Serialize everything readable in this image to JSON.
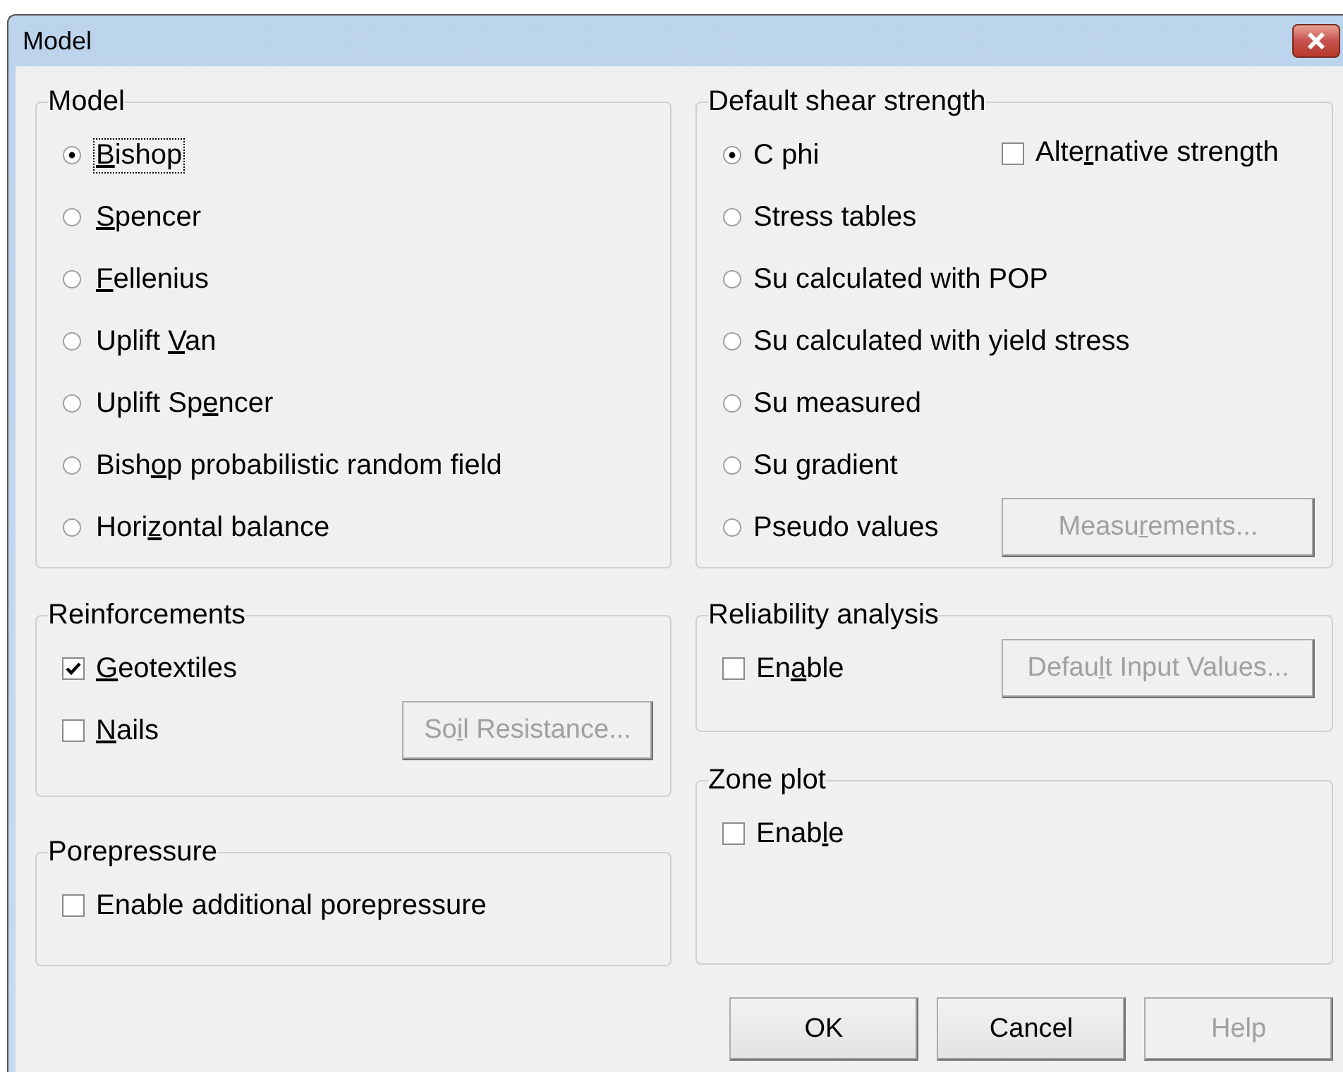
{
  "window": {
    "title": "Model"
  },
  "model": {
    "title": "Model",
    "options": [
      {
        "label": {
          "key": "B",
          "post": "ishop"
        },
        "selected": true,
        "focused": true
      },
      {
        "label": {
          "key": "S",
          "post": "pencer"
        },
        "selected": false,
        "focused": false
      },
      {
        "label": {
          "key": "F",
          "post": "ellenius"
        },
        "selected": false,
        "focused": false
      },
      {
        "label": {
          "pre": "Uplift ",
          "key": "V",
          "post": "an"
        },
        "selected": false,
        "focused": false
      },
      {
        "label": {
          "pre": "Uplift Sp",
          "key": "e",
          "post": "ncer"
        },
        "selected": false,
        "focused": false
      },
      {
        "label": {
          "pre": "Bish",
          "key": "o",
          "post": "p probabilistic random field"
        },
        "selected": false,
        "focused": false
      },
      {
        "label": {
          "pre": "Hori",
          "key": "z",
          "post": "ontal balance"
        },
        "selected": false,
        "focused": false
      }
    ]
  },
  "reinforcements": {
    "title": "Reinforcements",
    "checkboxes": [
      {
        "label": {
          "key": "G",
          "post": "eotextiles"
        },
        "checked": true
      },
      {
        "label": {
          "key": "N",
          "post": "ails"
        },
        "checked": false
      }
    ],
    "button": {
      "label": {
        "pre": "So",
        "key": "i",
        "post": "l Resistance..."
      },
      "disabled": true
    }
  },
  "porepressure": {
    "title": "Porepressure",
    "checkboxes": [
      {
        "label": {
          "pre": "Enable additional porepressure"
        },
        "checked": false
      }
    ]
  },
  "default_shear_strength": {
    "title": "Default shear strength",
    "options": [
      {
        "label": {
          "pre": "C phi"
        },
        "selected": true
      },
      {
        "label": {
          "pre": "Stress tables"
        },
        "selected": false
      },
      {
        "label": {
          "pre": "Su calculated with POP"
        },
        "selected": false
      },
      {
        "label": {
          "pre": "Su calculated with yield stress"
        },
        "selected": false
      },
      {
        "label": {
          "pre": "Su measured"
        },
        "selected": false
      },
      {
        "label": {
          "pre": "Su gradient"
        },
        "selected": false
      },
      {
        "label": {
          "pre": "Pseudo values"
        },
        "selected": false
      }
    ],
    "alternative_strength": {
      "label": {
        "pre": "Alte",
        "key": "r",
        "post": "native strength"
      },
      "checked": false
    },
    "button": {
      "label": {
        "pre": "Measu",
        "key": "r",
        "post": "ements..."
      },
      "disabled": true
    }
  },
  "reliability_analysis": {
    "title": "Reliability analysis",
    "checkboxes": [
      {
        "label": {
          "pre": "En",
          "key": "a",
          "post": "ble"
        },
        "checked": false
      }
    ],
    "button": {
      "label": {
        "pre": "Defau",
        "key": "l",
        "post": "t Input Values..."
      },
      "disabled": true
    }
  },
  "zone_plot": {
    "title": "Zone plot",
    "checkboxes": [
      {
        "label": {
          "pre": "Enab",
          "key": "l",
          "post": "e"
        },
        "checked": false
      }
    ]
  },
  "buttons": [
    {
      "label": {
        "pre": "OK"
      },
      "disabled": false
    },
    {
      "label": {
        "pre": "Cancel"
      },
      "disabled": false
    },
    {
      "label": {
        "pre": "Help"
      },
      "disabled": true
    }
  ]
}
